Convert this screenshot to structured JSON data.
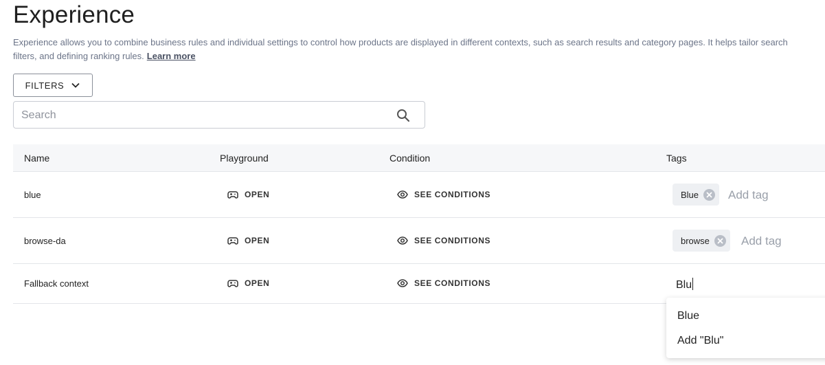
{
  "page": {
    "title": "Experience",
    "description_line1": "Experience allows you to combine business rules and individual settings to control how products are displayed in different contexts, such as search results and category pages. It helps tailor search",
    "description_line2": "filters, and defining ranking rules.",
    "learn_more": "Learn more"
  },
  "filters": {
    "label": "FILTERS",
    "icon": "chevron-down-icon"
  },
  "search": {
    "placeholder": "Search",
    "value": "",
    "icon": "search-icon"
  },
  "table": {
    "columns": {
      "name": "Name",
      "playground": "Playground",
      "condition": "Condition",
      "tags": "Tags"
    },
    "rows": [
      {
        "name": "blue",
        "playground": "OPEN",
        "condition": "SEE CONDITIONS",
        "tags": [
          "Blue"
        ],
        "add_tag": "Add tag"
      },
      {
        "name": "browse-da",
        "playground": "OPEN",
        "condition": "SEE CONDITIONS",
        "tags": [
          "browse"
        ],
        "add_tag": "Add tag"
      },
      {
        "name": "Fallback context",
        "playground": "OPEN",
        "condition": "SEE CONDITIONS",
        "tags": [],
        "tag_input": "Blu"
      }
    ]
  },
  "tag_dropdown": {
    "options": [
      "Blue",
      "Add \"Blu\""
    ]
  }
}
